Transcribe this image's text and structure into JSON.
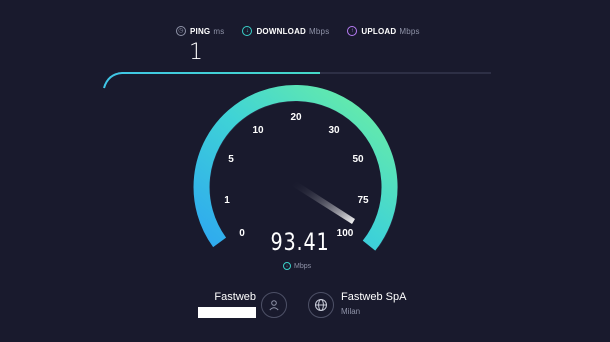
{
  "header": {
    "ping_label": "PING",
    "ping_unit": "ms",
    "download_label": "DOWNLOAD",
    "download_unit": "Mbps",
    "upload_label": "UPLOAD",
    "upload_unit": "Mbps",
    "ping_value": "1"
  },
  "icons": {
    "ping": "ping-clock-icon",
    "download": "download-arrow-icon",
    "upload": "upload-arrow-icon",
    "user": "user-icon",
    "server": "globe-icon"
  },
  "gauge": {
    "ticks": [
      "0",
      "1",
      "5",
      "10",
      "20",
      "30",
      "50",
      "75",
      "100"
    ],
    "value": "93.41",
    "unit": "Mbps",
    "max_label": "100"
  },
  "isp": {
    "name": "Fastweb"
  },
  "server": {
    "name": "Fastweb SpA",
    "city": "Milan"
  },
  "colors": {
    "background": "#191a2d",
    "ping": "#8f93a8",
    "download": "#3ad0c8",
    "upload": "#b77cf5",
    "gauge_start": "#2ea8f0",
    "gauge_end": "#6ef0a0"
  }
}
